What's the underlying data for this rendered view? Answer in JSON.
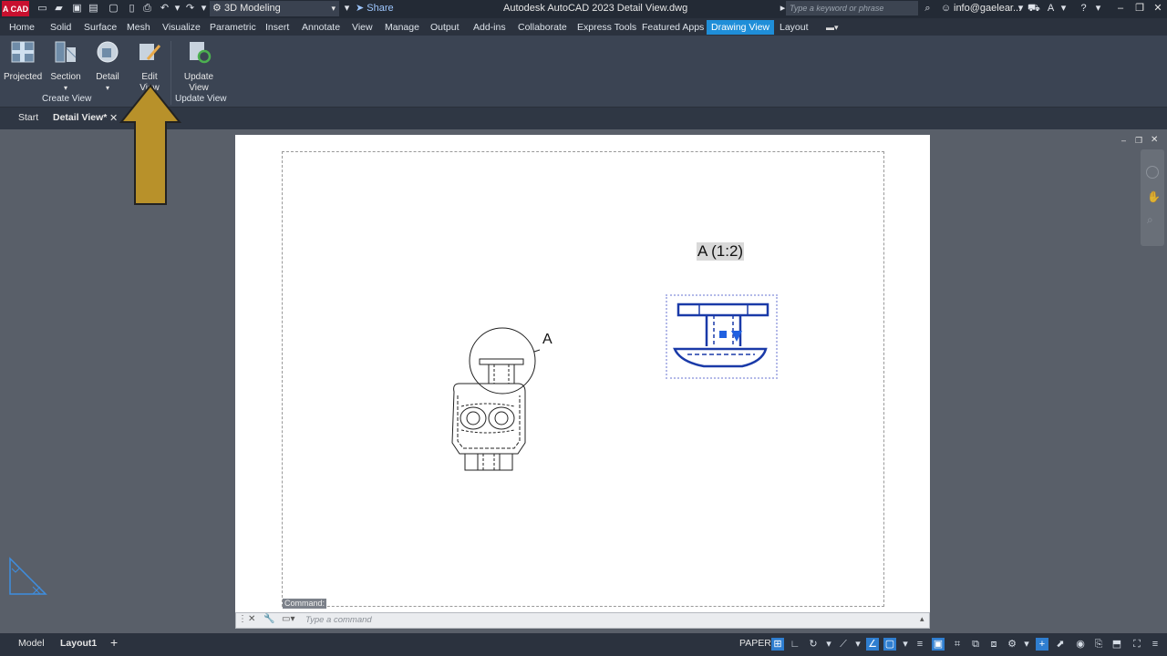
{
  "app": {
    "logo_text": "A CAD",
    "window_title": "Autodesk AutoCAD 2023    Detail View.dwg",
    "workspace": "3D Modeling",
    "share_label": "Share",
    "search_placeholder": "Type a keyword or phrase",
    "user": "info@gaelear...",
    "colors": {
      "accent": "#1f8ed8",
      "logo_bg": "#c8102e",
      "arrow_fill": "#b8912a"
    }
  },
  "ribbon": {
    "tabs": [
      "Home",
      "Solid",
      "Surface",
      "Mesh",
      "Visualize",
      "Parametric",
      "Insert",
      "Annotate",
      "View",
      "Manage",
      "Output",
      "Add-ins",
      "Collaborate",
      "Express Tools",
      "Featured Apps",
      "Drawing View",
      "Layout"
    ],
    "active_tab": "Drawing View",
    "create_view": {
      "panel_label": "Create View",
      "projected": "Projected",
      "section": "Section",
      "detail": "Detail",
      "edit_view_line1": "Edit",
      "edit_view_line2": "View"
    },
    "update_view": {
      "panel_label": "Update View",
      "update_line1": "Update",
      "update_line2": "View"
    }
  },
  "file_tabs": {
    "start": "Start",
    "active": "Detail View*"
  },
  "drawing": {
    "detail_label": "A",
    "detail_view_title": "A (1:2)"
  },
  "command": {
    "label": "Command:",
    "placeholder": "Type a command"
  },
  "status": {
    "model": "Model",
    "layout": "Layout1",
    "paper": "PAPER"
  }
}
